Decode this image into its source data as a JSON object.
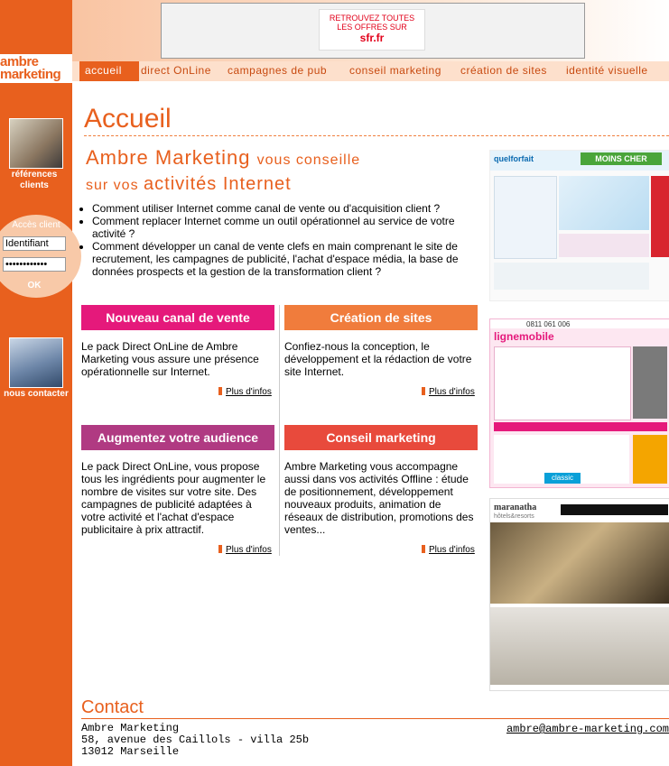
{
  "banner": {
    "line1": "RETROUVEZ TOUTES",
    "line2": "LES OFFRES SUR",
    "brand": "sfr.fr"
  },
  "logo": {
    "line1": "ambre",
    "line2": "marketing"
  },
  "nav": {
    "items": [
      "accueil",
      "direct OnLine",
      "campagnes de pub",
      "conseil marketing",
      "création de sites",
      "identité visuelle"
    ]
  },
  "sidebar": {
    "references": "références clients",
    "login_title": "Accès client",
    "login_id": "Identifiant",
    "login_pw": "••••••••••••",
    "ok": "OK",
    "contact": "nous contacter"
  },
  "main": {
    "title": "Accueil",
    "headline": {
      "brand": "Ambre Marketing",
      "rest1": "vous conseille",
      "pre2": "sur vos",
      "big2": "activités Internet"
    },
    "bullets": [
      "Comment utiliser Internet comme canal de vente ou d'acquisition client ?",
      "Comment replacer Internet comme un outil opérationnel au service de votre activité ?",
      "Comment développer un canal de vente clefs en main comprenant le site de recrutement, les campagnes de publicité, l'achat d'espace média, la base de données prospects et la gestion de la transformation client ?"
    ],
    "cards": [
      {
        "title": "Nouveau canal de vente",
        "color": "#e5197b",
        "text": "Le pack Direct OnLine de Ambre Marketing vous assure une présence opérationnelle sur Internet.",
        "more": "Plus d'infos"
      },
      {
        "title": "Création de sites",
        "color": "#f07c3c",
        "text": "Confiez-nous la conception, le développement et la rédaction de votre site Internet.",
        "more": "Plus d'infos"
      },
      {
        "title": "Augmentez votre audience",
        "color": "#b03a82",
        "text": "Le pack Direct OnLine, vous propose tous les ingrédients pour augmenter le nombre de visites sur votre site. Des campagnes de publicité adaptées à votre activité et l'achat d'espace publicitaire à prix attractif.",
        "more": "Plus d'infos"
      },
      {
        "title": "Conseil marketing",
        "color": "#e84a3c",
        "text": "Ambre Marketing vous accompagne aussi dans vos activités Offline : étude de positionnement, développement nouveaux produits, animation de réseaux de distribution, promotions des ventes...",
        "more": "Plus d'infos"
      }
    ]
  },
  "screenshots": {
    "s1": {
      "brand": "quelforfait",
      "tag": "MOINS CHER"
    },
    "s2": {
      "brand": "lignemobile",
      "phone": "0811 061 006",
      "promo": "classic"
    },
    "s3": {
      "brand": "maranatha",
      "sub": "hôtels&resorts"
    }
  },
  "contact": {
    "title": "Contact",
    "name": "Ambre Marketing",
    "street": "58, avenue des Caillols - villa 25b",
    "city": "13012 Marseille",
    "email": "ambre@ambre-marketing.com"
  }
}
